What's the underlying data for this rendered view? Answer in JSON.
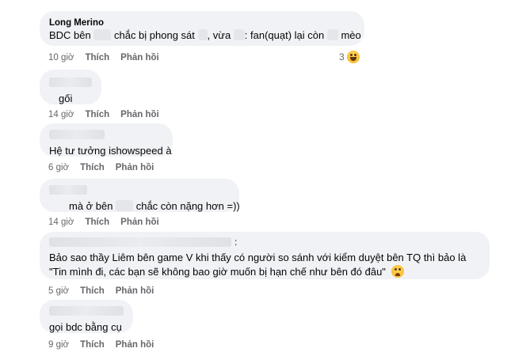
{
  "comments": [
    {
      "author": "Long Merino",
      "text_parts": [
        "BDC bên ",
        " chắc bị phong sát ",
        ", vừa ",
        ": fan(quạt) lại còn ",
        " mèo"
      ],
      "time": "10 giờ",
      "like": "Thích",
      "reply": "Phản hồi",
      "reaction_count": "3",
      "reaction_icon": "laughing-emoji"
    },
    {
      "author": "",
      "text": "gối",
      "time": "14 giờ",
      "like": "Thích",
      "reply": "Phản hồi"
    },
    {
      "author": "",
      "text": "Hệ tư tưởng ishowspeed à",
      "time": "6 giờ",
      "like": "Thích",
      "reply": "Phản hồi"
    },
    {
      "author": "",
      "text_parts": [
        "mà ở bên ",
        " chắc còn nặng hơn =))"
      ],
      "time": "14 giờ",
      "like": "Thích",
      "reply": "Phản hồi"
    },
    {
      "author": "",
      "author_suffix": ":",
      "text": "Bảo sao thầy Liêm bên game V khi thấy có người so sánh với kiểm duyệt bên TQ thì bảo là \"Tin mình đi, các bạn sẽ không bao giờ muốn bị hạn chế như bên đó đâu\"",
      "emoji": "sad-emoji",
      "time": "5 giờ",
      "like": "Thích",
      "reply": "Phản hồi"
    },
    {
      "author": "",
      "text": "gọi bdc bằng cụ",
      "time": "9 giờ",
      "like": "Thích",
      "reply": "Phản hồi"
    }
  ],
  "colors": {
    "bubble": "#f0f2f5",
    "meta": "#65676b",
    "text": "#050505"
  }
}
